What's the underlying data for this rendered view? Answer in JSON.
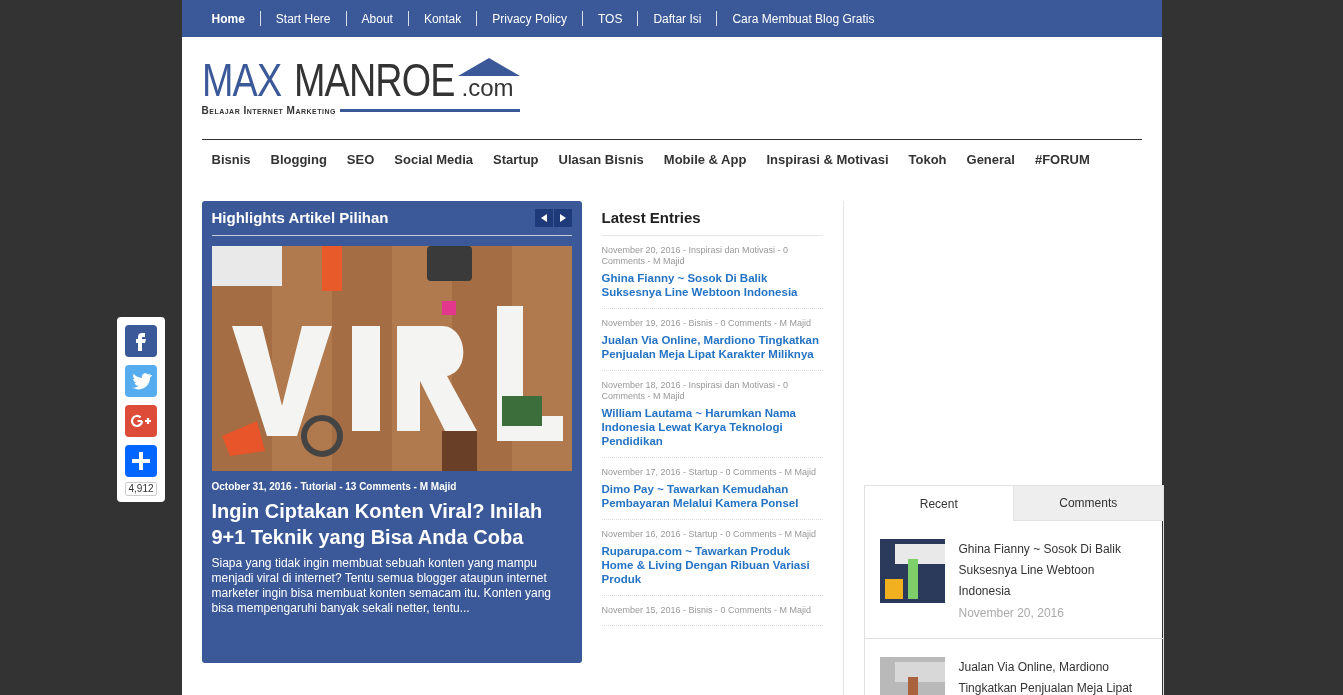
{
  "top_nav": [
    {
      "label": "Home",
      "selected": true
    },
    {
      "label": "Start Here",
      "selected": false
    },
    {
      "label": "About",
      "selected": false
    },
    {
      "label": "Kontak",
      "selected": false
    },
    {
      "label": "Privacy Policy",
      "selected": false
    },
    {
      "label": "TOS",
      "selected": false
    },
    {
      "label": "Daftar Isi",
      "selected": false
    },
    {
      "label": "Cara Membuat Blog Gratis",
      "selected": false
    }
  ],
  "logo": {
    "part1": "MAX",
    "part2": "MANROE",
    "suffix": ".com",
    "tagline": "Belajar Internet Marketing"
  },
  "category_nav": [
    "Bisnis",
    "Blogging",
    "SEO",
    "Social Media",
    "Startup",
    "Ulasan Bisnis",
    "Mobile & App",
    "Inspirasi & Motivasi",
    "Tokoh",
    "General",
    "#FORUM"
  ],
  "highlights": {
    "title": "Highlights Artikel Pilihan",
    "meta": "October 31, 2016 - Tutorial - 13 Comments - M Majid",
    "headline": "Ingin Ciptakan Konten Viral? Inilah 9+1 Teknik yang Bisa Anda Coba",
    "excerpt": "Siapa yang tidak ingin membuat sebuah konten yang mampu menjadi viral di internet? Tentu semua blogger ataupun internet marketer ingin bisa membuat konten semacam itu. Konten yang bisa mempengaruhi banyak sekali netter, tentu..."
  },
  "latest_entries": {
    "title": "Latest Entries",
    "items": [
      {
        "meta": "November 20, 2016 - Inspirasi dan Motivasi - 0 Comments - M Majid",
        "title": "Ghina Fianny ~ Sosok Di Balik Suksesnya Line Webtoon Indonesia"
      },
      {
        "meta": "November 19, 2016 - Bisnis - 0 Comments - M Majid",
        "title": "Jualan Via Online, Mardiono Tingkatkan Penjualan Meja Lipat Karakter Miliknya"
      },
      {
        "meta": "November 18, 2016 - Inspirasi dan Motivasi - 0 Comments - M Majid",
        "title": "William Lautama ~ Harumkan Nama Indonesia Lewat Karya Teknologi Pendidikan"
      },
      {
        "meta": "November 17, 2016 - Startup - 0 Comments - M Majid",
        "title": "Dimo Pay ~ Tawarkan Kemudahan Pembayaran Melalui Kamera Ponsel"
      },
      {
        "meta": "November 16, 2016 - Startup - 0 Comments - M Majid",
        "title": "Ruparupa.com ~ Tawarkan Produk Home & Living Dengan Ribuan Variasi Produk"
      },
      {
        "meta": "November 15, 2016 - Bisnis - 0 Comments - M Majid"
      }
    ]
  },
  "widget_tabs": [
    {
      "label": "Recent",
      "selected": true
    },
    {
      "label": "Comments",
      "selected": false
    }
  ],
  "recent_posts": [
    {
      "title": "Ghina Fianny ~ Sosok Di Balik Suksesnya Line Webtoon Indonesia",
      "date": "November 20, 2016"
    },
    {
      "title": "Jualan Via Online, Mardiono Tingkatkan Penjualan Meja Lipat"
    }
  ],
  "share_bar": {
    "buttons": [
      {
        "kind": "facebook"
      },
      {
        "kind": "twitter"
      },
      {
        "kind": "googleplus"
      },
      {
        "kind": "share"
      }
    ],
    "count": "4,912"
  }
}
